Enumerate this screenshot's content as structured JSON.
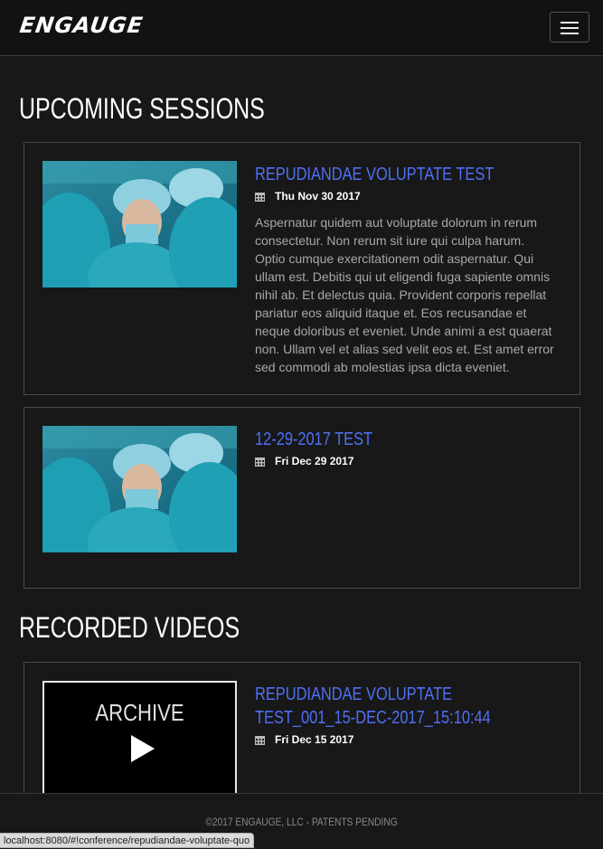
{
  "header": {
    "brand": "ENGAUGE",
    "menu_icon": "hamburger-menu-icon"
  },
  "upcoming": {
    "title": "UPCOMING SESSIONS",
    "sessions": [
      {
        "title": "REPUDIANDAE VOLUPTATE TEST",
        "date": "Thu Nov 30 2017",
        "description": "Aspernatur quidem aut voluptate dolorum in rerum consectetur. Non rerum sit iure qui culpa harum. Optio cumque exercitationem odit aspernatur. Qui ullam est. Debitis qui ut eligendi fuga sapiente omnis nihil ab. Et delectus quia. Provident corporis repellat pariatur eos aliquid itaque et. Eos recusandae et neque doloribus et eveniet. Unde animi a est quaerat non. Ullam vel et alias sed velit eos et. Est amet error sed commodi ab molestias ipsa dicta eveniet."
      },
      {
        "title": "12-29-2017 TEST",
        "date": "Fri Dec 29 2017",
        "description": ""
      }
    ]
  },
  "recorded": {
    "title": "RECORDED VIDEOS",
    "videos": [
      {
        "title": "REPUDIANDAE VOLUPTATE TEST_001_15-DEC-2017_15:10:44",
        "date": "Fri Dec 15 2017",
        "thumb_label": "ARCHIVE"
      }
    ]
  },
  "footer": {
    "text": "©2017 ENGAUGE, LLC - PATENTS PENDING"
  },
  "status_bar": {
    "url": "localhost:8080/#!conference/repudiandae-voluptate-quo"
  },
  "colors": {
    "accent": "#4f6ff5",
    "background": "#181818",
    "header_bg": "#121212"
  }
}
